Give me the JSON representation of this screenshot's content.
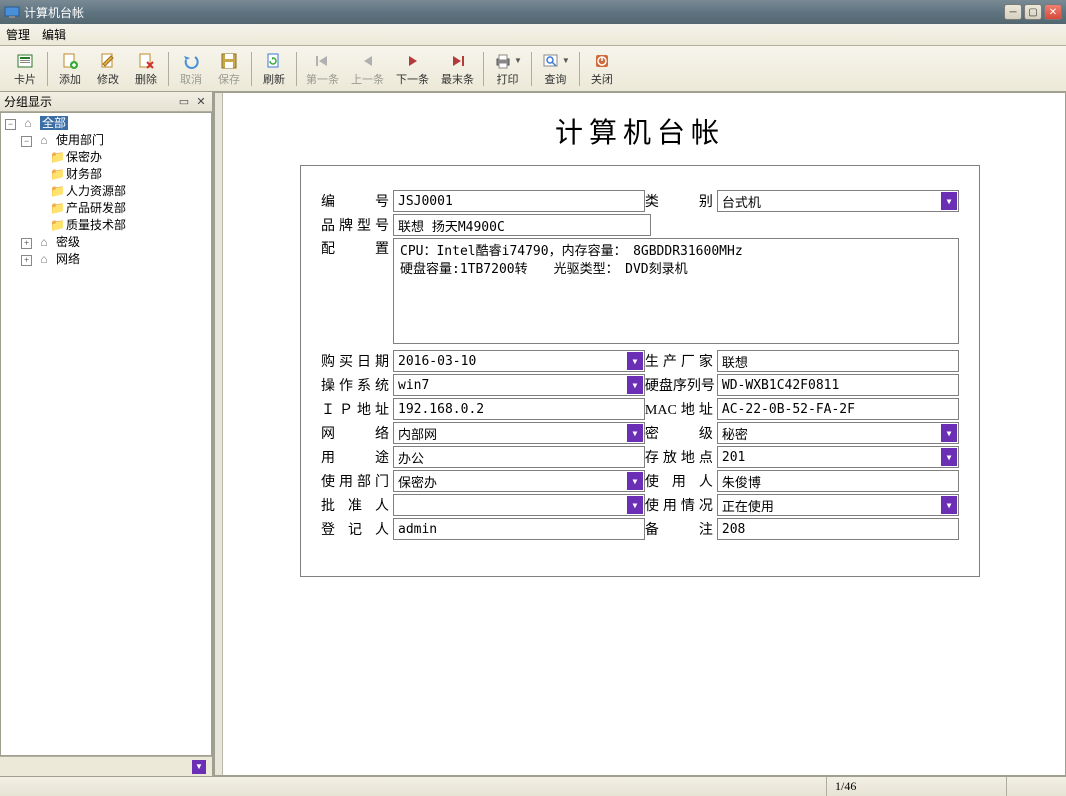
{
  "window": {
    "title": "计算机台帐"
  },
  "menu": {
    "items": [
      "管理",
      "编辑"
    ]
  },
  "toolbar": {
    "card": "卡片",
    "add": "添加",
    "edit": "修改",
    "delete": "删除",
    "cancel": "取消",
    "save": "保存",
    "refresh": "刷新",
    "first": "第一条",
    "prev": "上一条",
    "next": "下一条",
    "last": "最末条",
    "print": "打印",
    "query": "查询",
    "close": "关闭"
  },
  "sidebar": {
    "header": "分组显示",
    "tree": {
      "root": "全部",
      "dept": "使用部门",
      "dept_children": [
        "保密办",
        "财务部",
        "人力资源部",
        "产品研发部",
        "质量技术部"
      ],
      "level": "密级",
      "net": "网络"
    }
  },
  "page": {
    "title": "计算机台帐"
  },
  "form": {
    "id_label": "编　号",
    "id": "JSJ0001",
    "type_label": "类　别",
    "type": "台式机",
    "brand_label": "品牌型号",
    "brand": "联想 扬天M4900C",
    "config_label": "配　置",
    "config": "CPU：Intel酷睿i74790，内存容量：　8GBDDR31600MHz\n硬盘容量:1TB7200转　　光驱类型：　DVD刻录机",
    "buydate_label": "购买日期",
    "buydate": "2016-03-10",
    "vendor_label": "生产厂家",
    "vendor": "联想",
    "os_label": "操作系统",
    "os": "win7",
    "hdsn_label": "硬盘序列号",
    "hdsn": "WD-WXB1C42F0811",
    "ip_label": "ＩＰ地址",
    "ip": "192.168.0.2",
    "mac_label": "MAC地址",
    "mac": "AC-22-0B-52-FA-2F",
    "net_label": "网　络",
    "net": "内部网",
    "secret_label": "密　级",
    "secret": "秘密",
    "use_label": "用　途",
    "use": "办公",
    "loc_label": "存放地点",
    "loc": "201",
    "dept_label": "使用部门",
    "dept": "保密办",
    "user_label": "使 用 人",
    "user": "朱俊博",
    "approver_label": "批 准 人",
    "approver": "",
    "status_label": "使用情况",
    "status": "正在使用",
    "reg_label": "登 记 人",
    "reg": "admin",
    "remark_label": "备　注",
    "remark": "208"
  },
  "status": {
    "pager": "1/46"
  }
}
